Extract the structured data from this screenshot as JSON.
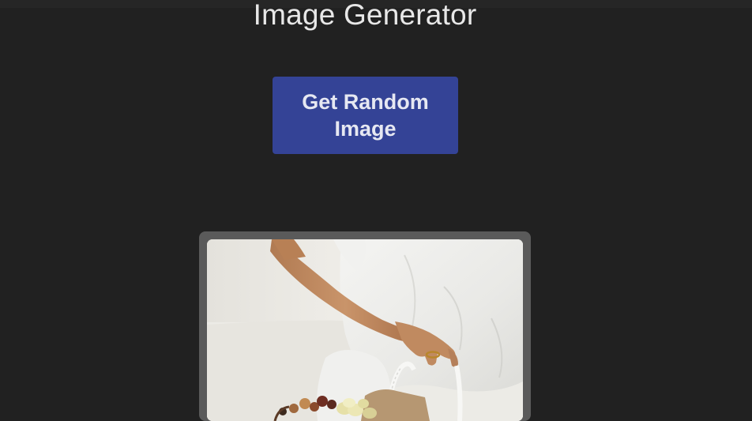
{
  "page": {
    "title": "Image Generator"
  },
  "controls": {
    "random_button_label": "Get Random Image"
  },
  "image": {
    "alt": "Random generated image",
    "subject": "person in white clothing holding a woven basket with food"
  },
  "colors": {
    "background": "#212121",
    "button": "#344396",
    "frame": "#5a5a5a"
  }
}
